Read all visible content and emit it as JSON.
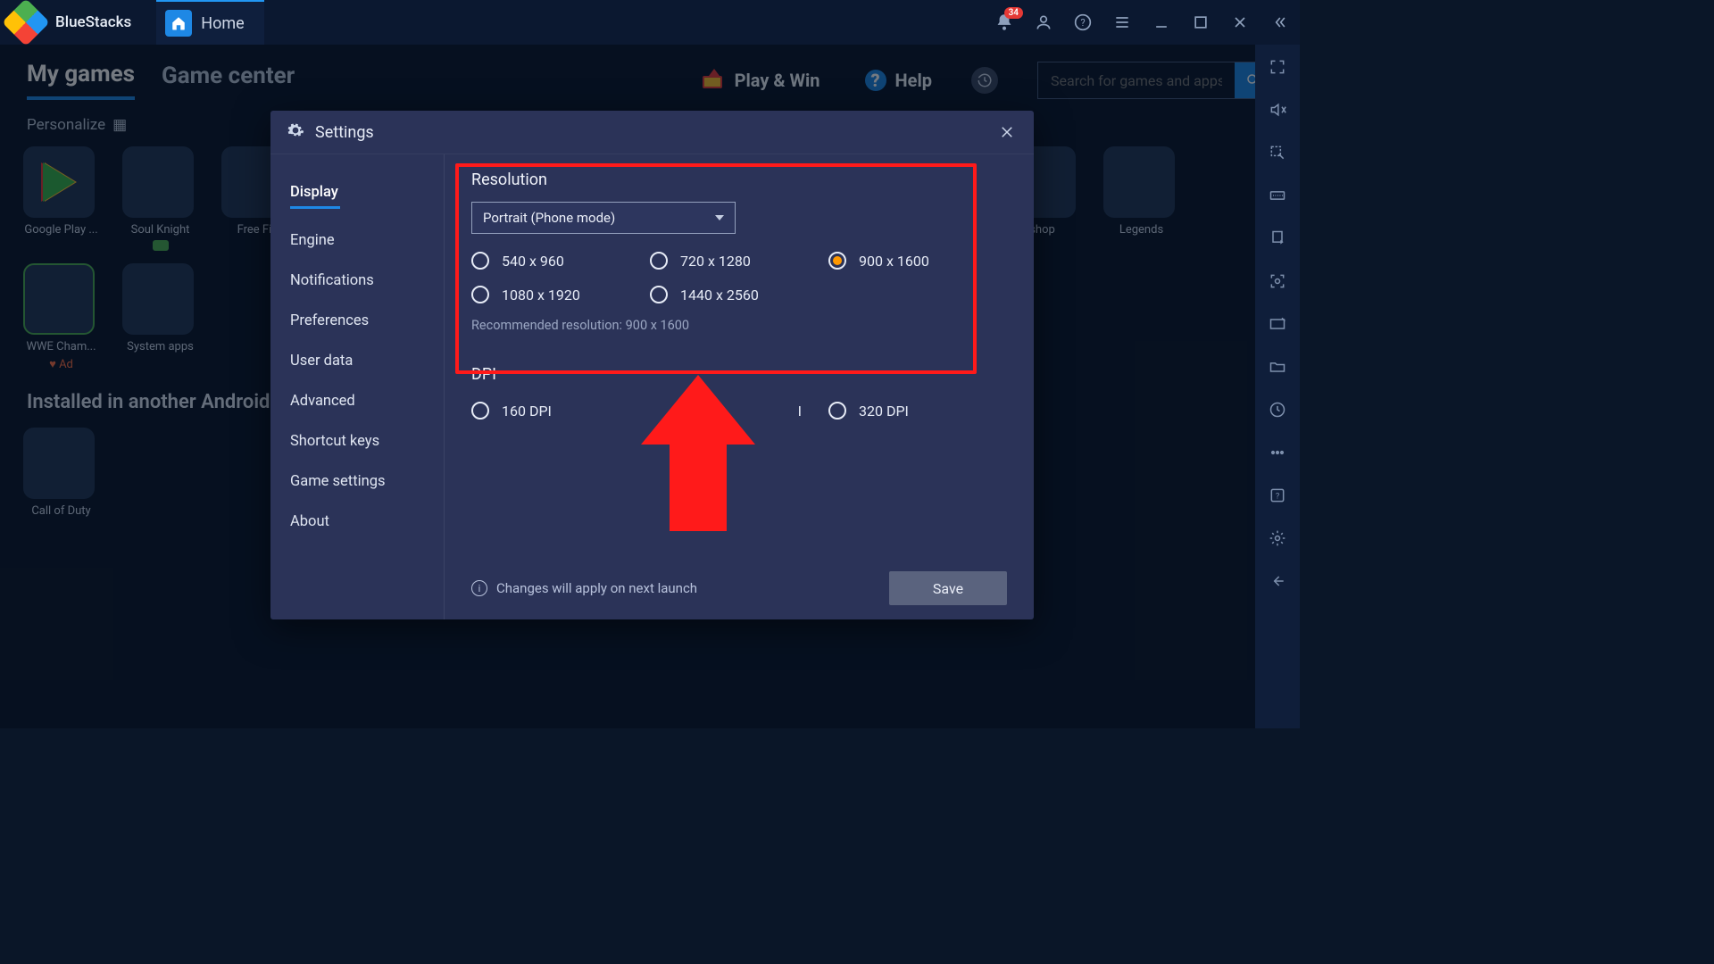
{
  "titlebar": {
    "brand": "BlueStacks",
    "homeTab": "Home",
    "notifCount": "34"
  },
  "nav": {
    "myGames": "My games",
    "gameCenter": "Game center",
    "playWin": "Play & Win",
    "help": "Help",
    "searchPlaceholder": "Search for games and apps"
  },
  "personalize": "Personalize",
  "apps": {
    "gp": "Google Play ...",
    "sk": "Soul Knight",
    "ff": "Free Fire",
    "shop": "shop",
    "lg": "Legends",
    "wwe": "WWE Cham...",
    "sys": "System apps",
    "ad": "Ad",
    "cod": "Call of Duty"
  },
  "installedHeader": "Installed in another Android e",
  "modal": {
    "title": "Settings",
    "side": {
      "display": "Display",
      "engine": "Engine",
      "notifications": "Notifications",
      "preferences": "Preferences",
      "userData": "User data",
      "advanced": "Advanced",
      "shortcut": "Shortcut keys",
      "gameSettings": "Game settings",
      "about": "About"
    },
    "resolution": {
      "title": "Resolution",
      "mode": "Portrait (Phone mode)",
      "r1": "540 x 960",
      "r2": "720 x 1280",
      "r3": "900 x 1600",
      "r4": "1080 x 1920",
      "r5": "1440 x 2560",
      "hint": "Recommended resolution: 900 x 1600"
    },
    "dpi": {
      "title": "DPI",
      "d1": "160 DPI",
      "d2": "I",
      "d3": "320 DPI"
    },
    "footerInfo": "Changes will apply on next launch",
    "save": "Save"
  }
}
